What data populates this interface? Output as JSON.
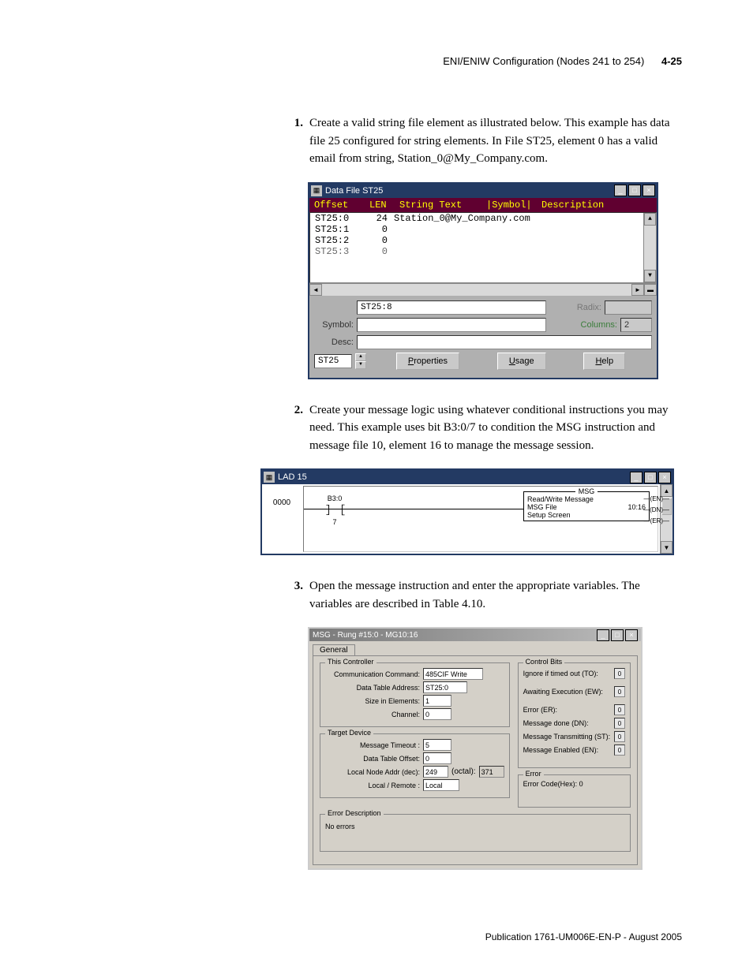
{
  "header": {
    "title": "ENI/ENIW Configuration (Nodes 241 to 254)",
    "page": "4-25"
  },
  "steps": {
    "s1": "Create a valid string file element as illustrated below. This example has data file 25 configured for string elements. In File ST25, element 0 has a valid email from string, Station_0@My_Company.com.",
    "s2": "Create your message logic using whatever conditional instructions you may need. This example uses bit B3:0/7 to condition the MSG instruction and message file 10, element 16 to manage the message session.",
    "s3": "Open the message instruction and enter the appropriate variables. The variables are described in Table 4.10."
  },
  "win1": {
    "title": "Data File ST25",
    "col_offset": "Offset",
    "col_len": "LEN",
    "col_txt": "String Text",
    "col_sym": "|Symbol|",
    "col_desc": "Description",
    "rows": [
      {
        "off": "ST25:0",
        "len": "24",
        "txt": "Station_0@My_Company.com"
      },
      {
        "off": "ST25:1",
        "len": "0",
        "txt": ""
      },
      {
        "off": "ST25:2",
        "len": "0",
        "txt": ""
      },
      {
        "off": "ST25:3",
        "len": "0",
        "txt": ""
      }
    ],
    "addr_value": "ST25:8",
    "radix_label": "Radix:",
    "symbol_label": "Symbol:",
    "columns_label": "Columns:",
    "columns_value": "2",
    "desc_label": "Desc:",
    "file_nav": "ST25",
    "btn_properties": "Properties",
    "btn_usage": "Usage",
    "btn_help": "Help"
  },
  "win2": {
    "title": "LAD 15",
    "rung_no": "0000",
    "contact_addr": "B3:0",
    "contact_bit": "7",
    "msg_title": "MSG",
    "msg_line1": "Read/Write Message",
    "msg_line2_l": "MSG File",
    "msg_line2_r": "10:16",
    "msg_line3": "Setup Screen",
    "flag_en": "EN",
    "flag_dn": "DN",
    "flag_er": "ER"
  },
  "win3": {
    "title": "MSG - Rung #15:0 - MG10:16",
    "tab": "General",
    "this_ctrl": "This Controller",
    "comm_cmd_lbl": "Communication Command:",
    "comm_cmd_val": "485CIF Write",
    "dta_lbl": "Data Table Address:",
    "dta_val": "ST25:0",
    "size_lbl": "Size in Elements:",
    "size_val": "1",
    "chan_lbl": "Channel:",
    "chan_val": "0",
    "target": "Target Device",
    "mto_lbl": "Message Timeout :",
    "mto_val": "5",
    "dto_lbl": "Data Table Offset:",
    "dto_val": "0",
    "lna_lbl": "Local Node Addr (dec):",
    "lna_val": "249",
    "lna_oct_lbl": "(octal):",
    "lna_oct_val": "371",
    "lr_lbl": "Local / Remote :",
    "lr_val": "Local",
    "ctrl_bits": "Control Bits",
    "cb_to": "Ignore if timed out (TO):",
    "cb_ew": "Awaiting Execution (EW):",
    "cb_er": "Error (ER):",
    "cb_dn": "Message done (DN):",
    "cb_st": "Message Transmitting (ST):",
    "cb_en": "Message Enabled (EN):",
    "cb_val": "0",
    "err_grp": "Error",
    "err_code": "Error Code(Hex): 0",
    "err_desc_grp": "Error Description",
    "no_err": "No errors"
  },
  "footer": "Publication 1761-UM006E-EN-P - August 2005"
}
